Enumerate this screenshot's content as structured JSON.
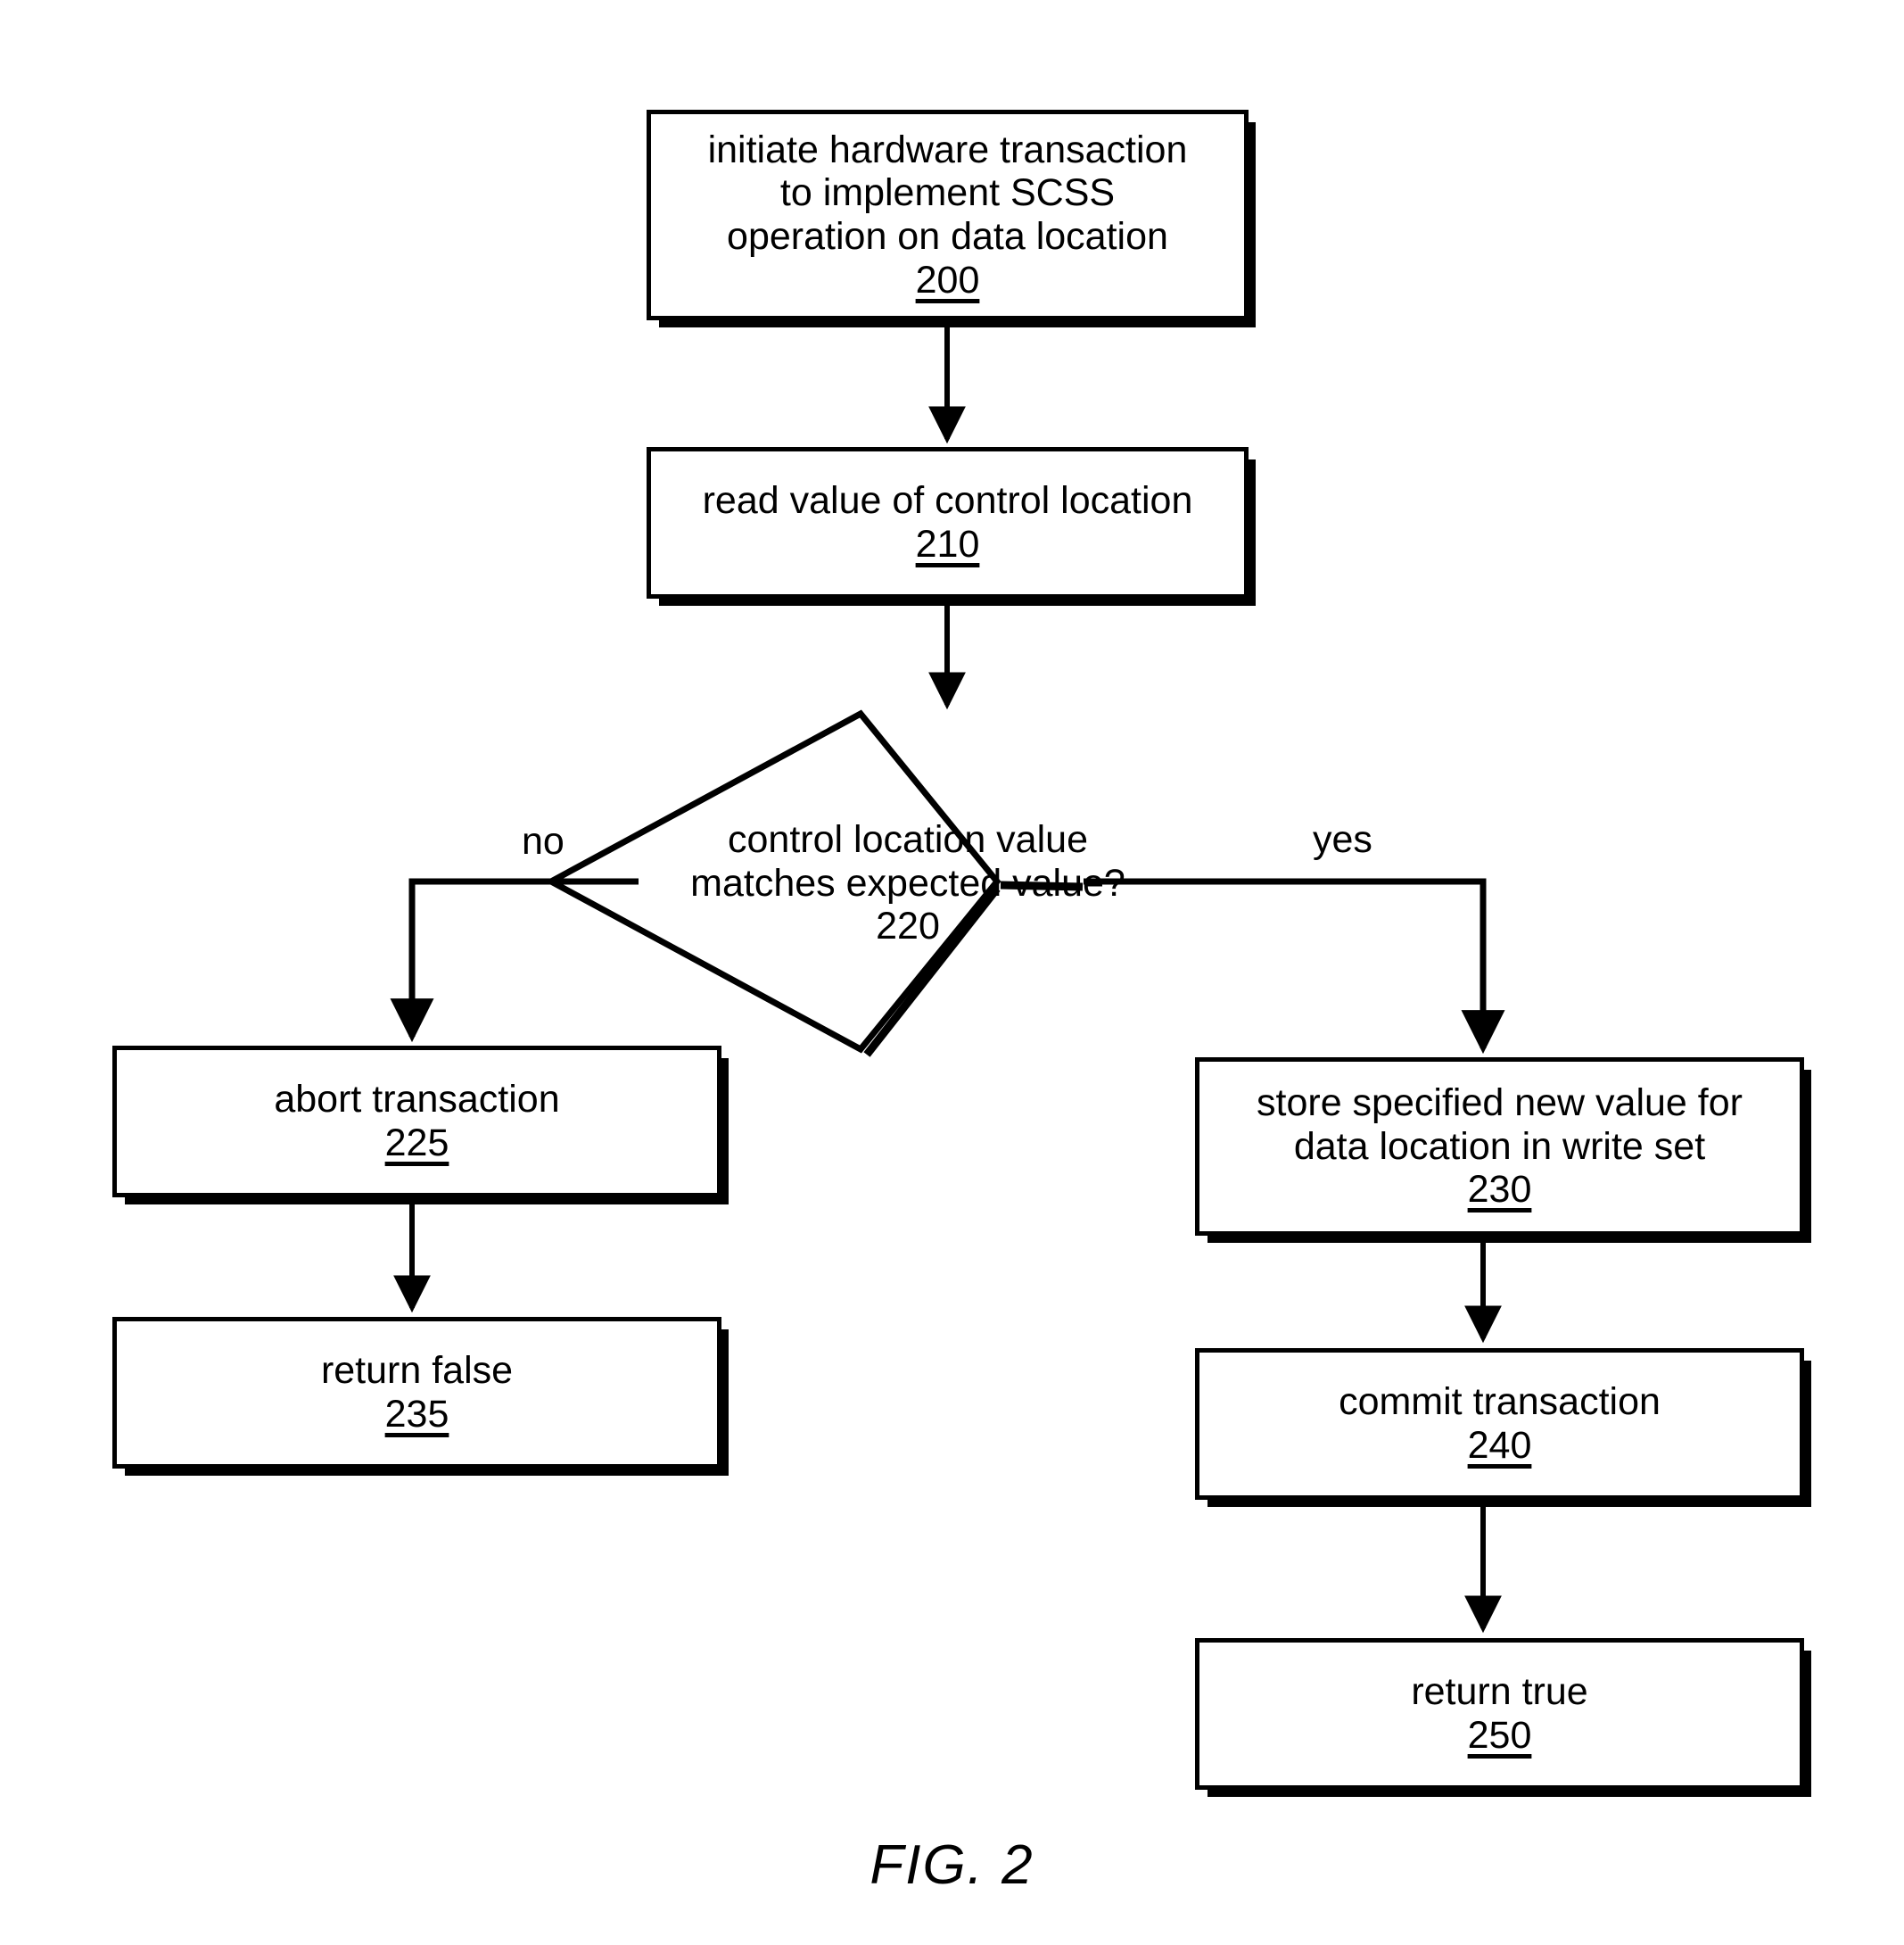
{
  "figure": {
    "caption": "FIG. 2"
  },
  "chart_data": {
    "type": "diagram",
    "title": "FIG. 2",
    "diagram_kind": "flowchart",
    "nodes": [
      {
        "id": "200",
        "shape": "process",
        "text": "initiate hardware transaction\nto implement SCSS\noperation on data location",
        "ref": "200"
      },
      {
        "id": "210",
        "shape": "process",
        "text": "read value of control location",
        "ref": "210"
      },
      {
        "id": "220",
        "shape": "decision",
        "text": "control\nlocation value\nmatches expected\nvalue?",
        "ref": "220"
      },
      {
        "id": "225",
        "shape": "process",
        "text": "abort transaction",
        "ref": "225"
      },
      {
        "id": "235",
        "shape": "process",
        "text": "return false",
        "ref": "235"
      },
      {
        "id": "230",
        "shape": "process",
        "text": "store specified new value for\ndata location in write set",
        "ref": "230"
      },
      {
        "id": "240",
        "shape": "process",
        "text": "commit transaction",
        "ref": "240"
      },
      {
        "id": "250",
        "shape": "process",
        "text": "return true",
        "ref": "250"
      }
    ],
    "edges": [
      {
        "from": "200",
        "to": "210",
        "label": ""
      },
      {
        "from": "210",
        "to": "220",
        "label": ""
      },
      {
        "from": "220",
        "to": "225",
        "label": "no"
      },
      {
        "from": "220",
        "to": "230",
        "label": "yes"
      },
      {
        "from": "225",
        "to": "235",
        "label": ""
      },
      {
        "from": "230",
        "to": "240",
        "label": ""
      },
      {
        "from": "240",
        "to": "250",
        "label": ""
      }
    ],
    "edge_labels": {
      "no": "no",
      "yes": "yes"
    },
    "colors": {
      "stroke": "#000000",
      "fill": "#ffffff",
      "text": "#000000"
    }
  }
}
